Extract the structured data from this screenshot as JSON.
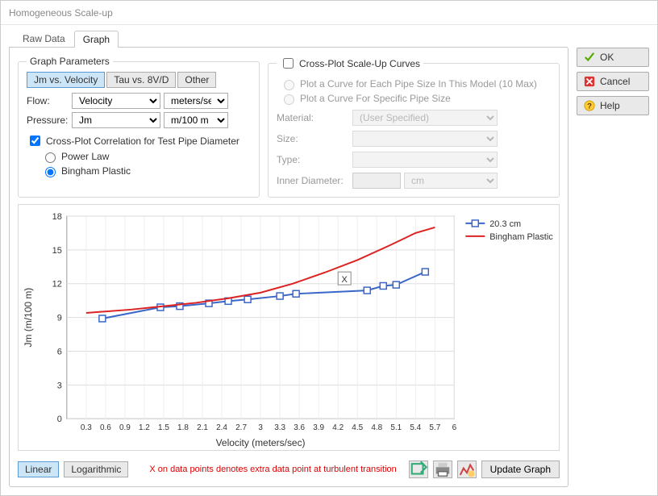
{
  "window": {
    "title": "Homogeneous Scale-up"
  },
  "side_buttons": {
    "ok": "OK",
    "cancel": "Cancel",
    "help": "Help"
  },
  "tabs": {
    "raw": "Raw Data",
    "graph": "Graph"
  },
  "graph_params": {
    "legend": "Graph Parameters",
    "modes": {
      "jm_velocity": "Jm vs. Velocity",
      "tau_8vd": "Tau vs. 8V/D",
      "other": "Other"
    },
    "flow_label": "Flow:",
    "flow_value": "Velocity",
    "flow_unit": "meters/sec",
    "pressure_label": "Pressure:",
    "pressure_value": "Jm",
    "pressure_unit": "m/100 m"
  },
  "crossplot_corr": {
    "checkbox": "Cross-Plot Correlation for Test Pipe Diameter",
    "powerlaw": "Power Law",
    "bingham": "Bingham Plastic"
  },
  "scaleup": {
    "legend": "Cross-Plot Scale-Up Curves",
    "opt_each": "Plot a Curve for Each Pipe Size In This Model (10 Max)",
    "opt_specific": "Plot a Curve For Specific Pipe Size",
    "material_label": "Material:",
    "material_value": "(User Specified)",
    "size_label": "Size:",
    "type_label": "Type:",
    "innerdia_label": "Inner Diameter:",
    "innerdia_unit": "cm"
  },
  "chart_controls": {
    "linear": "Linear",
    "log": "Logarithmic",
    "note": "X on data points denotes extra data point at turbulent transition",
    "update": "Update Graph"
  },
  "chart_data": {
    "type": "line",
    "xlabel": "Velocity (meters/sec)",
    "ylabel": "Jm (m/100 m)",
    "xlim": [
      0,
      6
    ],
    "ylim": [
      0,
      18
    ],
    "xticks": [
      0.3,
      0.6,
      0.9,
      1.2,
      1.5,
      1.8,
      2.1,
      2.4,
      2.7,
      3,
      3.3,
      3.6,
      3.9,
      4.2,
      4.5,
      4.8,
      5.1,
      5.4,
      5.7,
      6
    ],
    "yticks": [
      0,
      3,
      6,
      9,
      12,
      15,
      18
    ],
    "series": [
      {
        "name": "20.3 cm",
        "color": "#3a66c8",
        "marker": "square",
        "x": [
          0.55,
          1.45,
          1.75,
          2.2,
          2.5,
          2.8,
          3.3,
          3.55,
          4.65,
          4.9,
          5.1,
          5.55
        ],
        "y": [
          8.9,
          9.9,
          10.0,
          10.25,
          10.45,
          10.6,
          10.9,
          11.1,
          11.4,
          11.8,
          11.9,
          13.05
        ]
      },
      {
        "name": "Bingham Plastic",
        "color": "#d22",
        "marker": "none",
        "x": [
          0.3,
          1.0,
          1.5,
          2.0,
          2.5,
          3.0,
          3.5,
          4.0,
          4.5,
          5.0,
          5.4,
          5.7
        ],
        "y": [
          9.4,
          9.7,
          10.0,
          10.3,
          10.7,
          11.2,
          12.0,
          13.0,
          14.1,
          15.4,
          16.5,
          17.0
        ]
      }
    ],
    "annotations": [
      {
        "text": "X",
        "x": 4.3,
        "y": 12.4
      }
    ]
  }
}
